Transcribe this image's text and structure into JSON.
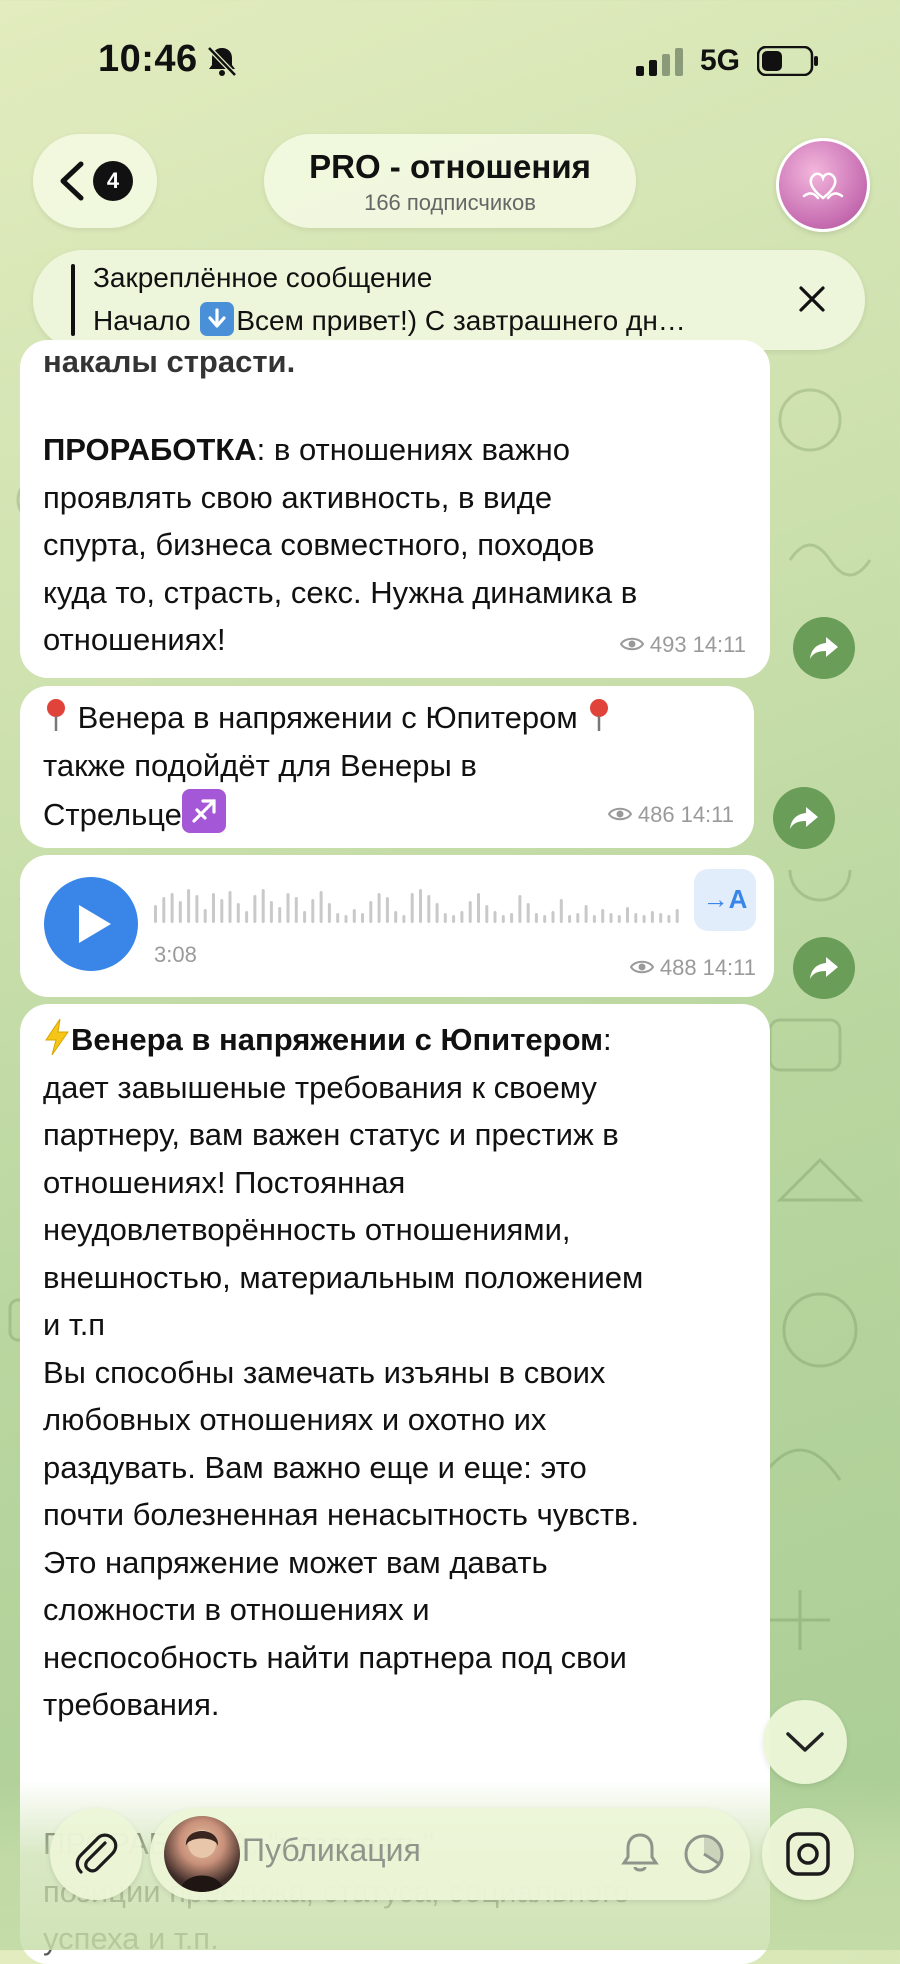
{
  "status_bar": {
    "time": "10:46",
    "network": "5G",
    "icons": [
      "bell-off-icon",
      "signal-icon",
      "battery-icon"
    ]
  },
  "header": {
    "back_badge": "4",
    "channel_name": "PRO - отношения",
    "subscribers": "166 подписчиков"
  },
  "pinned": {
    "label": "Закреплённое сообщение",
    "text_before": "Начало ",
    "text_after": "Всем привет!) С завтрашнего дн…"
  },
  "messages": [
    {
      "partial_heading": "накалы страсти.",
      "bold": "ПРОРАБОТКА",
      "text": ": в отношениях важно\nпроявлять свою активность, в виде\nспурта, бизнеса совместного, походов\nкуда то, страсть, секс. Нужна динамика в\nотношениях!",
      "views": "493",
      "time": "14:11"
    },
    {
      "line1": " Венера в напряжении с Юпитером ",
      "line2": "также подойдёт для Венеры в",
      "line3": "Стрельце",
      "views": "486",
      "time": "14:11"
    },
    {
      "voice_duration": "3:08",
      "transcribe_label": "→A",
      "views": "488",
      "time": "14:11"
    },
    {
      "bold": "Венера в напряжении с Юпитером",
      "text": ":\nдает завышеные требования к своему\nпартнеру, вам важен статус и престиж в\nотношениях! Постоянная\nнеудовлетворённость отношениями,\nвнешностью, материальным положением\nи т.п\nВы способны замечать изъяны в своих\nлюбовных отношениях и охотно их\nраздувать. Вам важно еще и еще: это\nпочти болезненная ненасытность чувств.\nЭто напряжение может вам давать\nсложности в отношениях и\nнеспособность найти партнера под свои\nтребования."
    },
    {
      "partial_text": "ПРОРАБОТКА: \"раздувать\"\nпозиции престижа, статуса, социального\nуспеха и т.п."
    }
  ],
  "composer": {
    "placeholder": "Публикация"
  },
  "colors": {
    "accent_blue": "#3a86e8",
    "share_green": "#6a9d58",
    "bubble": "#ffffff"
  }
}
